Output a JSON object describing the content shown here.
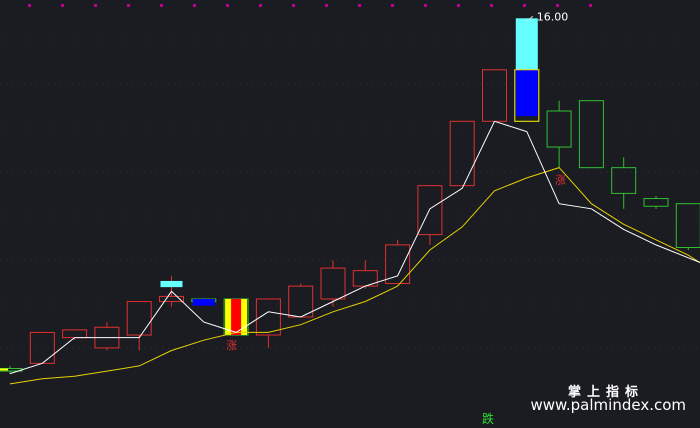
{
  "chart_data": {
    "type": "candlestick",
    "ylim": [
      8.2,
      16.2
    ],
    "high_label": "16.00",
    "signal_up_label": "涨",
    "signal_down_label": "跌",
    "colors": {
      "up": "#e03030",
      "down": "#30c030",
      "ma_fast": "#ffffff",
      "ma_slow": "#e6d200",
      "highlight_cyan": "#66ffff",
      "highlight_blue": "#0000ff",
      "highlight_red": "#ff0000",
      "highlight_yellow": "#ffff00",
      "grid": "#c00090"
    },
    "candles": [
      {
        "open": 9.2,
        "close": 9.15,
        "high": 9.25,
        "low": 9.1
      },
      {
        "open": 9.3,
        "close": 9.9,
        "high": 9.9,
        "low": 9.3
      },
      {
        "open": 9.8,
        "close": 9.95,
        "high": 9.95,
        "low": 9.75
      },
      {
        "open": 9.6,
        "close": 10.0,
        "high": 10.1,
        "low": 9.55
      },
      {
        "open": 9.85,
        "close": 10.5,
        "high": 10.5,
        "low": 9.55
      },
      {
        "open": 10.5,
        "close": 10.6,
        "high": 11.0,
        "low": 10.4
      },
      {
        "open": 10.55,
        "close": 10.5,
        "high": 10.55,
        "low": 10.5
      },
      {
        "open": 10.55,
        "close": 9.85,
        "high": 10.55,
        "low": 9.85
      },
      {
        "open": 9.85,
        "close": 10.55,
        "high": 10.55,
        "low": 9.6
      },
      {
        "open": 10.2,
        "close": 10.8,
        "high": 10.85,
        "low": 10.2
      },
      {
        "open": 10.55,
        "close": 11.15,
        "high": 11.3,
        "low": 10.4
      },
      {
        "open": 10.8,
        "close": 11.1,
        "high": 11.3,
        "low": 10.75
      },
      {
        "open": 10.85,
        "close": 11.6,
        "high": 11.7,
        "low": 10.85
      },
      {
        "open": 11.8,
        "close": 12.75,
        "high": 12.75,
        "low": 11.6
      },
      {
        "open": 12.75,
        "close": 14.0,
        "high": 14.0,
        "low": 12.75
      },
      {
        "open": 14.0,
        "close": 15.0,
        "high": 15.0,
        "low": 14.0
      },
      {
        "open": 15.0,
        "close": 14.0,
        "high": 16.0,
        "low": 14.0
      },
      {
        "open": 14.2,
        "close": 13.5,
        "high": 14.4,
        "low": 13.1
      },
      {
        "open": 14.4,
        "close": 13.1,
        "high": 14.4,
        "low": 13.1
      },
      {
        "open": 13.1,
        "close": 12.6,
        "high": 13.3,
        "low": 12.3
      },
      {
        "open": 12.5,
        "close": 12.35,
        "high": 12.55,
        "low": 12.3
      },
      {
        "open": 12.4,
        "close": 11.55,
        "high": 12.4,
        "low": 11.5
      },
      {
        "open": 11.45,
        "close": 11.2,
        "high": 11.55,
        "low": 11.2
      }
    ],
    "ma_fast": [
      9.1,
      9.3,
      9.8,
      9.8,
      9.8,
      10.7,
      10.1,
      9.9,
      10.3,
      10.2,
      10.5,
      10.8,
      11.0,
      12.3,
      12.7,
      14.0,
      13.8,
      12.4,
      12.3,
      11.9,
      11.6,
      11.35,
      11.1
    ],
    "ma_slow": [
      8.9,
      9.0,
      9.05,
      9.15,
      9.25,
      9.55,
      9.75,
      9.9,
      9.9,
      10.05,
      10.3,
      10.5,
      10.8,
      11.5,
      11.95,
      12.65,
      12.9,
      13.1,
      12.4,
      12.0,
      11.7,
      11.4,
      11.0
    ]
  },
  "watermark": {
    "line1": "掌上指标",
    "line2": "www.palmindex.com"
  }
}
